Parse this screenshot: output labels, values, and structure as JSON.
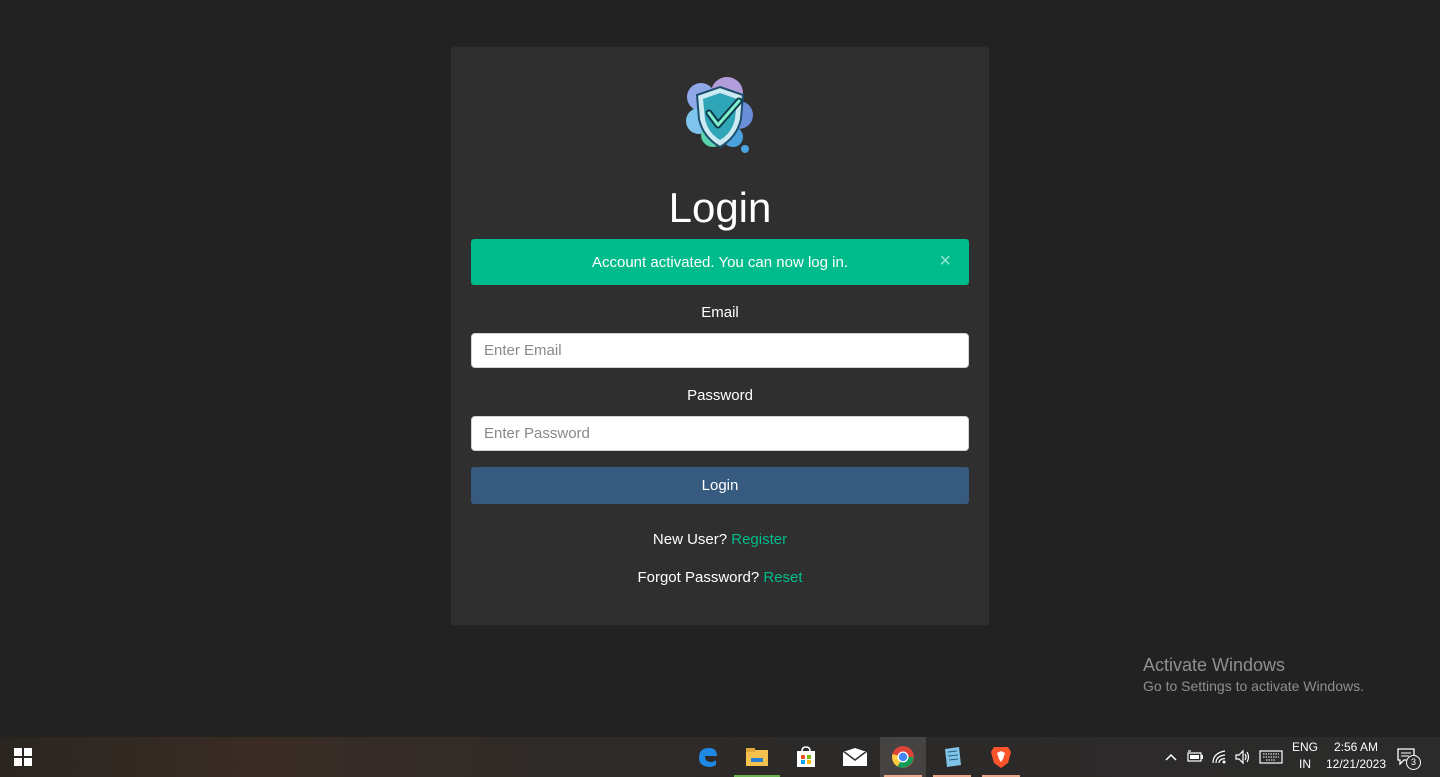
{
  "login": {
    "title": "Login",
    "alert_message": "Account activated. You can now log in.",
    "alert_close": "×",
    "email_label": "Email",
    "email_placeholder": "Enter Email",
    "email_value": "",
    "password_label": "Password",
    "password_placeholder": "Enter Password",
    "password_value": "",
    "submit_label": "Login",
    "new_user_text": "New User?",
    "register_link": "Register",
    "forgot_text": "Forgot Password?",
    "reset_link": "Reset"
  },
  "watermark": {
    "title": "Activate Windows",
    "subtitle": "Go to Settings to activate Windows."
  },
  "taskbar": {
    "apps": [
      "start-icon",
      "edge-icon",
      "file-explorer-icon",
      "microsoft-store-icon",
      "mail-icon",
      "chrome-icon",
      "notepad-icon",
      "brave-icon"
    ],
    "language_line1": "ENG",
    "language_line2": "IN",
    "time": "2:56 AM",
    "date": "12/21/2023",
    "notification_count": "3"
  },
  "colors": {
    "page_bg": "#222222",
    "card_bg": "#2f2f2f",
    "success": "#00bc8c",
    "primary": "#375a7f"
  }
}
